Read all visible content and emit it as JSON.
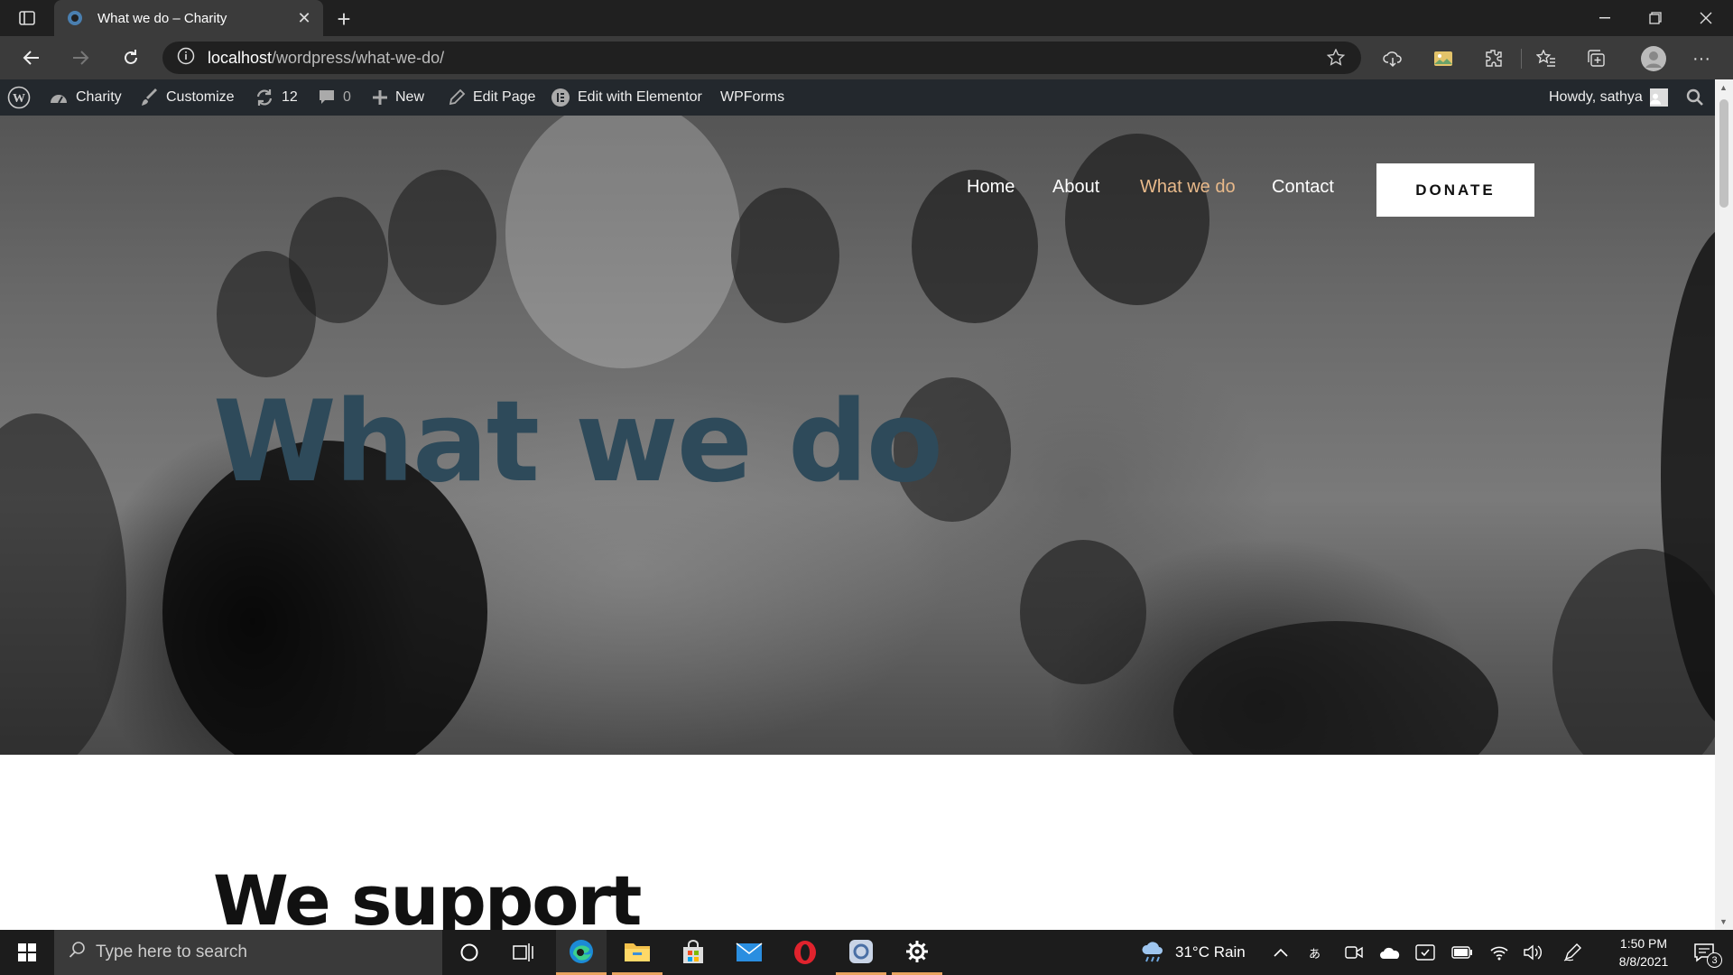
{
  "browser": {
    "tab_title": "What we do – Charity",
    "url_host": "localhost",
    "url_path": "/wordpress/what-we-do/"
  },
  "admin_bar": {
    "site_name": "Charity",
    "customize": "Customize",
    "updates_count": "12",
    "comments_count": "0",
    "new": "New",
    "edit_page": "Edit Page",
    "edit_elementor": "Edit with Elementor",
    "wpforms": "WPForms",
    "howdy": "Howdy, sathya"
  },
  "site_nav": {
    "items": [
      {
        "label": "Home"
      },
      {
        "label": "About"
      },
      {
        "label": "What we do"
      },
      {
        "label": "Contact"
      }
    ],
    "donate_label": "DONATE",
    "active_color": "#e8b98a"
  },
  "hero": {
    "title": "What we do",
    "title_color": "#2e4a5a"
  },
  "section": {
    "title": "We support"
  },
  "taskbar": {
    "search_placeholder": "Type here to search",
    "weather": "31°C  Rain",
    "time": "1:50 PM",
    "date": "8/8/2021",
    "notifications": "3"
  }
}
